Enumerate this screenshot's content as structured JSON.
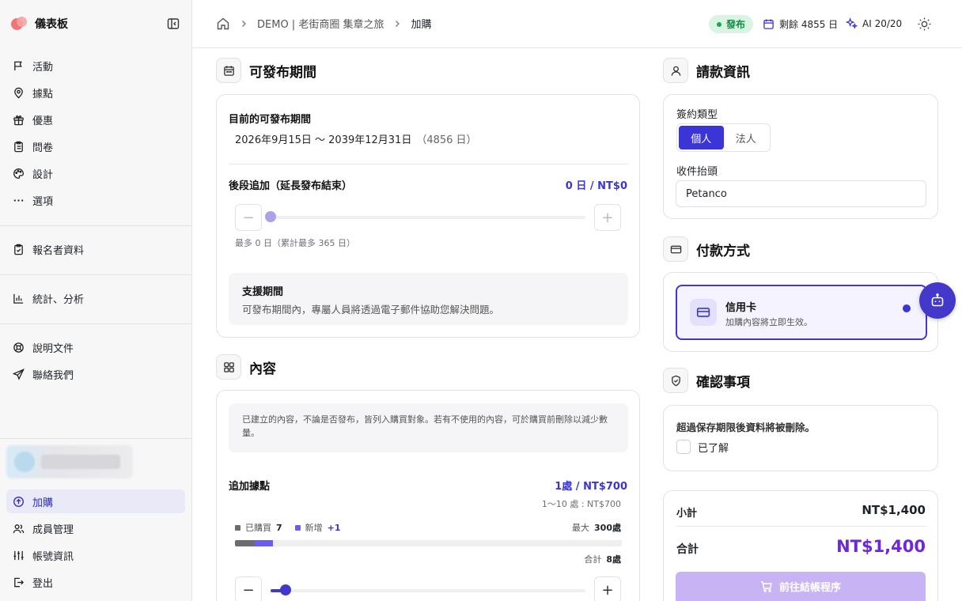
{
  "sidebar": {
    "brand": "儀表板",
    "nav": [
      "活動",
      "據點",
      "優惠",
      "問卷",
      "設計",
      "選項"
    ],
    "registrants": "報名者資料",
    "stats": "統計、分析",
    "docs": "說明文件",
    "contact": "聯絡我們",
    "bottom": [
      "加購",
      "成員管理",
      "帳號資訊",
      "登出"
    ]
  },
  "topbar": {
    "crumb_project": "DEMO | 老街商圈 集章之旅",
    "crumb_current": "加購",
    "status": "發布",
    "remaining": "剩餘 4855 日",
    "ai": "AI 20/20"
  },
  "period": {
    "title": "可發布期間",
    "current_label": "目前的可發布期間",
    "current_range": "2026年9月15日 〜 2039年12月31日",
    "current_days": "（4856 日）",
    "extend_label": "後段追加（延長發布結束）",
    "extend_value": "0 日 / NT$0",
    "extend_progress": 0,
    "extend_hint": "最多 0 日（累計最多 365 日）",
    "support_title": "支援期間",
    "support_text": "可發布期間內，專屬人員將透過電子郵件協助您解決問題。"
  },
  "content": {
    "title": "內容",
    "notice": "已建立的內容，不論是否發布，皆列入購買對象。若有不使用的內容，可於購買前刪除以減少數量。",
    "add_spots_label": "追加據點",
    "add_spots_value": "1處 / NT$700",
    "add_spots_price_rule": "1〜10 處 : NT$700",
    "purchased_label": "已購買",
    "purchased_count": "7",
    "new_label": "新增",
    "new_count": "+1",
    "max_label": "最大",
    "max_value": "300處",
    "total_label": "合計",
    "total_value": "8處",
    "usage_purchased": 7,
    "usage_new": 1,
    "usage_max": 300
  },
  "billing": {
    "title": "請款資訊",
    "contract_type_label": "簽約類型",
    "contract_options": [
      "個人",
      "法人"
    ],
    "recipient_label": "收件抬頭",
    "recipient_value": "Petanco"
  },
  "payment": {
    "title": "付款方式",
    "option_title": "信用卡",
    "option_desc": "加購內容將立即生效。"
  },
  "confirm": {
    "title": "確認事項",
    "warning": "超過保存期限後資料將被刪除。",
    "checkbox_label": "已了解"
  },
  "summary": {
    "subtotal_label": "小計",
    "subtotal_value": "NT$1,400",
    "total_label": "合計",
    "total_value": "NT$1,400",
    "checkout_label": "前往結帳程序"
  },
  "colors": {
    "accent": "#4338ca",
    "total": "#6d28d9",
    "publish_bg": "#d9f4e3",
    "checkout_disabled": "#c8b4f5"
  }
}
